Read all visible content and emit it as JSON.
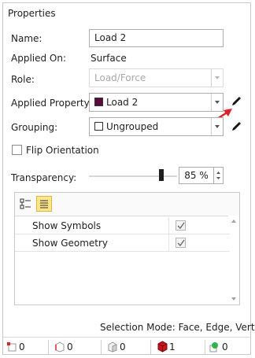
{
  "panel": {
    "title": "Properties"
  },
  "form": {
    "name_label": "Name:",
    "name_value": "Load 2",
    "applied_on_label": "Applied On:",
    "applied_on_value": "Surface",
    "role_label": "Role:",
    "role_value": "Load/Force",
    "applied_property_label": "Applied Property:",
    "applied_property_value": "Load 2",
    "applied_property_color": "#5a0c3c",
    "grouping_label": "Grouping:",
    "grouping_value": "Ungrouped",
    "flip_orientation_label": "Flip Orientation",
    "flip_orientation_checked": false,
    "transparency_label": "Transparency:",
    "transparency_value": "85 %",
    "transparency_level": 0.85
  },
  "display_grid": {
    "rows": [
      {
        "label": "Show Symbols",
        "checked": true
      },
      {
        "label": "Show Geometry",
        "checked": true
      }
    ]
  },
  "status": {
    "selection_mode": "Selection Mode: Face, Edge, Vertex",
    "counts": [
      {
        "icon": "point-select-icon",
        "value": "0"
      },
      {
        "icon": "edge-select-icon",
        "value": "0"
      },
      {
        "icon": "face-select-icon",
        "value": "0"
      },
      {
        "icon": "solid-select-icon",
        "value": "1"
      },
      {
        "icon": "node-select-icon",
        "value": "0"
      }
    ]
  },
  "colors": {
    "annotation_arrow": "#e31e24",
    "accent_highlight": "#fde58a"
  }
}
